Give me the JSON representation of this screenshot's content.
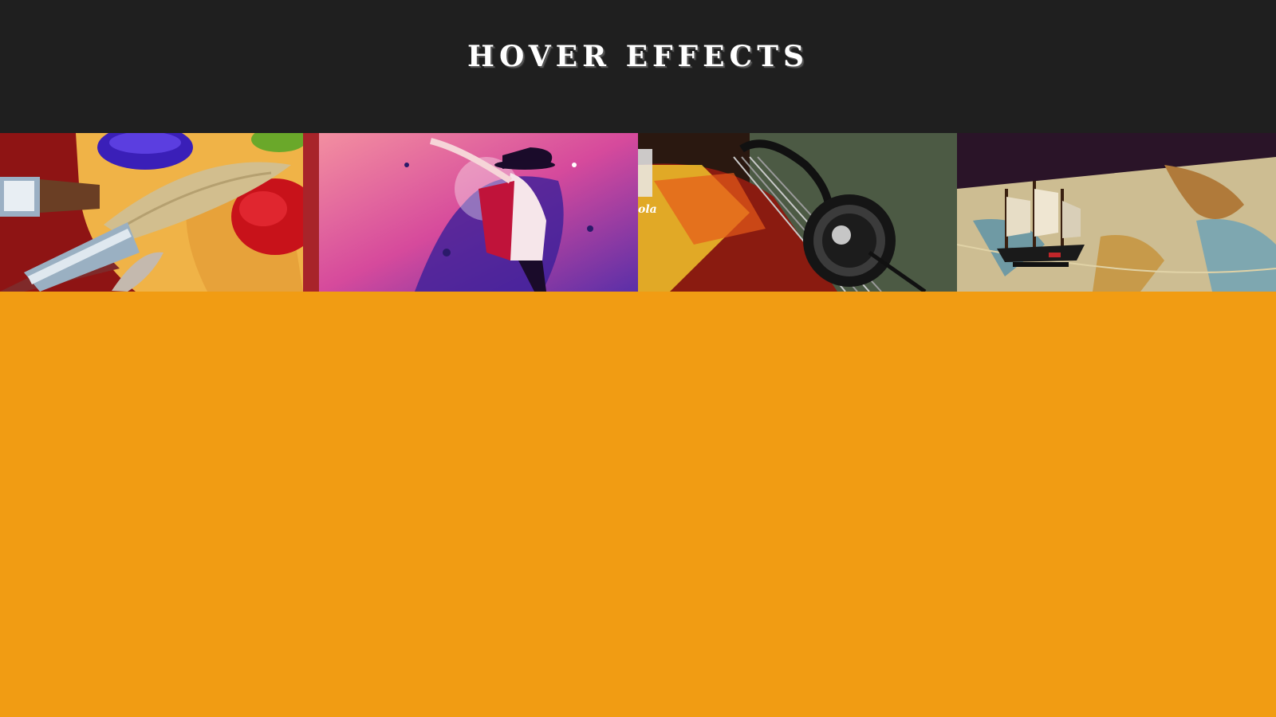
{
  "header": {
    "title": "HOVER EFFECTS"
  },
  "gallery": {
    "tiles": [
      {
        "subject": "paint-palette-image"
      },
      {
        "subject": "dancer-image"
      },
      {
        "subject": "headphones-image"
      },
      {
        "subject": "ship-on-map-image"
      }
    ],
    "tile3_logo_text": "ola"
  },
  "colors": {
    "header_bg": "#1f1f1f",
    "page_bg": "#f19c13",
    "title_color": "#ffffff"
  }
}
